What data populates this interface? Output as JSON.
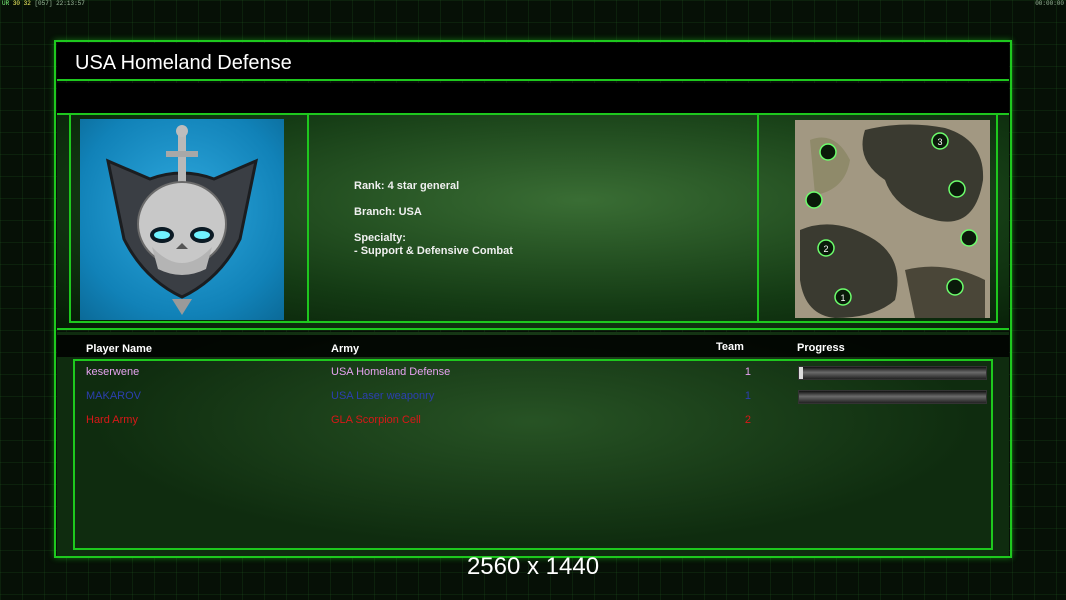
{
  "topbar": {
    "fps_a": "UR",
    "fps_b": "30",
    "fps_c": "32",
    "fps_d": "[057]",
    "clock": "22:13:57",
    "timer": "00:00:00"
  },
  "header": {
    "title": "USA Homeland Defense"
  },
  "general": {
    "rank": "Rank: 4 star general",
    "branch": "Branch: USA",
    "specialty_label": "Specialty:",
    "specialty_value": "- Support & Defensive Combat"
  },
  "table": {
    "columns": {
      "player": "Player Name",
      "army": "Army",
      "team": "Team",
      "progress": "Progress"
    },
    "rows": [
      {
        "player": "keserwene",
        "army": "USA Homeland Defense",
        "team": "1",
        "color": "#e6a2f0",
        "progress": 0.02,
        "has_progress": true
      },
      {
        "player": "MAKAROV",
        "army": "USA Laser weaponry",
        "team": "1",
        "color": "#2c3fb0",
        "progress": 0.0,
        "has_progress": true
      },
      {
        "player": "Hard Army",
        "army": "GLA Scorpion Cell",
        "team": "2",
        "color": "#d81818",
        "progress": 0.0,
        "has_progress": false
      }
    ]
  },
  "map": {
    "start_positions": [
      "1",
      "2",
      "3"
    ]
  },
  "footer": {
    "resolution": "2560 x 1440"
  },
  "colors": {
    "frame": "#1ec81e",
    "portrait_bg": "#1a8fc8"
  },
  "icons": {
    "portrait": "skull-sword-crest-icon",
    "map": "minimap-icon"
  }
}
